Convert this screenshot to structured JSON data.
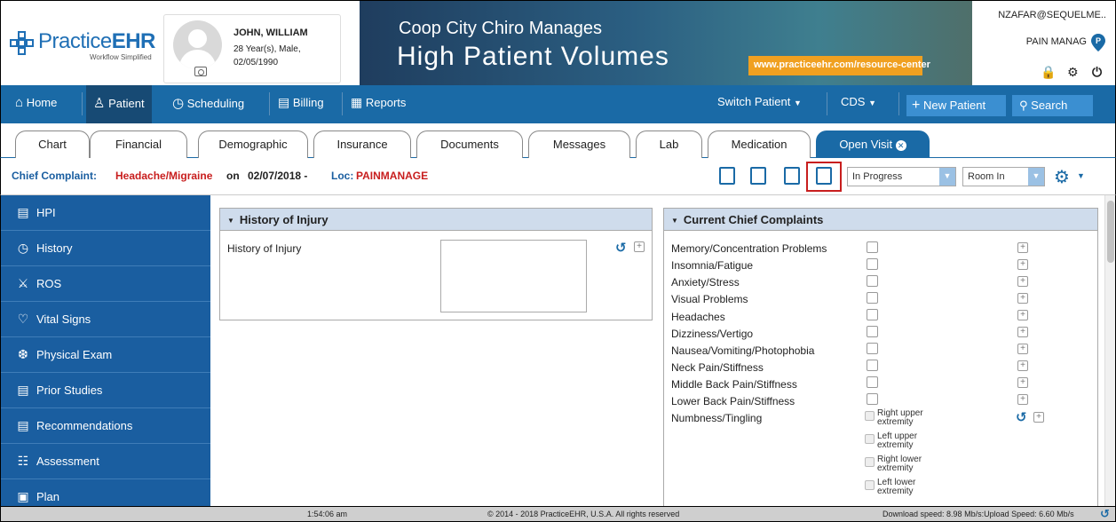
{
  "app": {
    "logo_brand_a": "Practice",
    "logo_brand_b": "EHR",
    "logo_tagline": "Workflow Simplified"
  },
  "patient": {
    "name": "JOHN, WILLIAM",
    "info": "28 Year(s), Male,",
    "dob": "02/05/1990"
  },
  "banner": {
    "line1": "Coop City Chiro Manages",
    "line2": "High Patient Volumes",
    "url": "www.practiceehr.com/resource-center"
  },
  "user": {
    "email": "NZAFAR@SEQUELME..",
    "practice": "PAIN MANAG",
    "practice_badge": "P"
  },
  "nav": {
    "home": "Home",
    "patient": "Patient",
    "scheduling": "Scheduling",
    "billing": "Billing",
    "reports": "Reports",
    "switch_patient": "Switch Patient",
    "cds": "CDS",
    "new_patient": "New Patient",
    "search": "Search"
  },
  "tabs": [
    "Chart",
    "Financial",
    "Demographic",
    "Insurance",
    "Documents",
    "Messages",
    "Lab",
    "Medication",
    "Open Visit"
  ],
  "complaint": {
    "label": "Chief Complaint:",
    "value": "Headache/Migraine",
    "on": "on",
    "date": "02/07/2018 -",
    "loc_label": "Loc:",
    "loc": "PAINMANAGE",
    "status": "In Progress",
    "room": "Room In"
  },
  "sidebar": [
    "HPI",
    "History",
    "ROS",
    "Vital Signs",
    "Physical Exam",
    "Prior Studies",
    "Recommendations",
    "Assessment",
    "Plan"
  ],
  "history_panel": {
    "title": "History of Injury",
    "field_label": "History of Injury"
  },
  "complaints_panel": {
    "title": "Current Chief Complaints",
    "items": [
      "Memory/Concentration Problems",
      "Insomnia/Fatigue",
      "Anxiety/Stress",
      "Visual Problems",
      "Headaches",
      "Dizziness/Vertigo",
      "Nausea/Vomiting/Photophobia",
      "Neck Pain/Stiffness",
      "Middle Back Pain/Stiffness",
      "Lower Back Pain/Stiffness",
      "Numbness/Tingling"
    ],
    "numbness_options": [
      "Right upper extremity",
      "Left upper extremity",
      "Right lower extremity",
      "Left lower extremity"
    ]
  },
  "footer": {
    "time": "1:54:06 am",
    "copyright": "© 2014 - 2018 PracticeEHR, U.S.A. All rights reserved",
    "speed": "Download speed: 8.98 Mb/s:Upload Speed: 6.60 Mb/s"
  },
  "colors": {
    "nav_blue": "#1a6aa6",
    "sidebar_blue": "#1a5ea0",
    "accent_red": "#c81e1e"
  }
}
